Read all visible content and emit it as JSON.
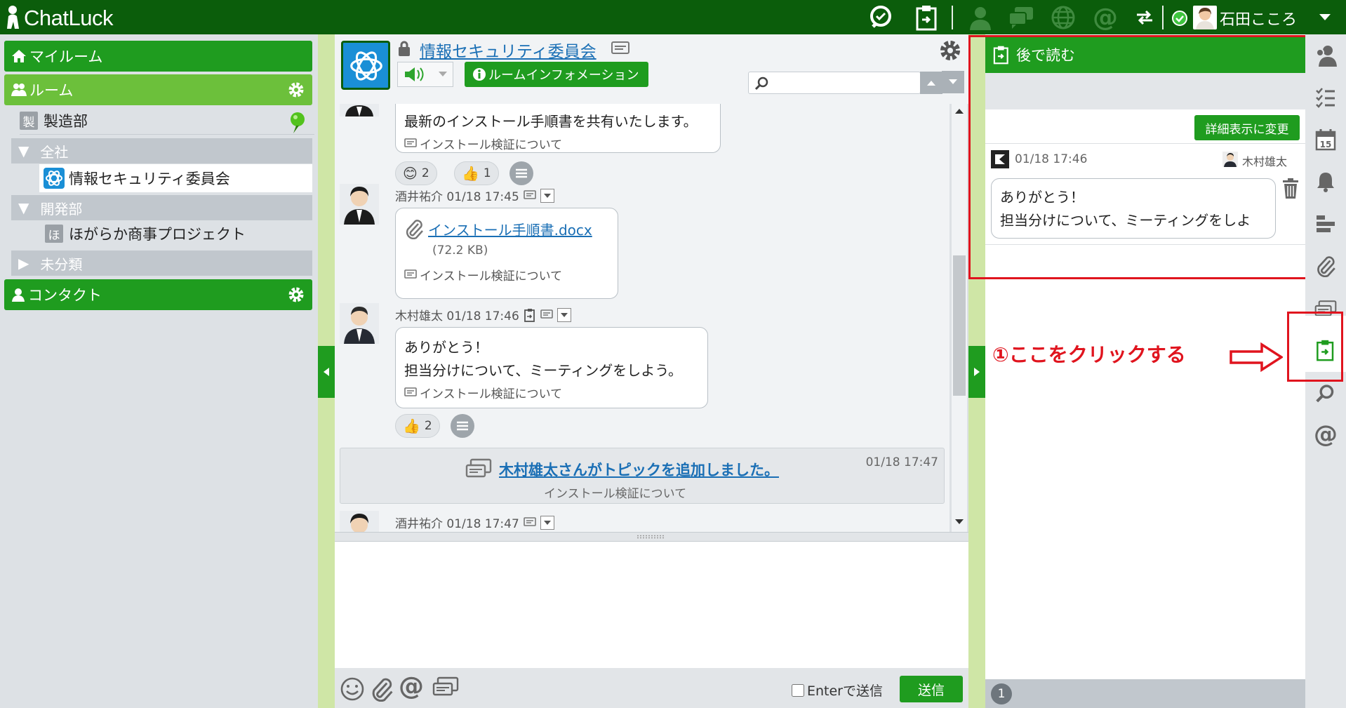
{
  "app": {
    "title": "ChatLuck"
  },
  "user": {
    "name": "石田こころ"
  },
  "sidebar": {
    "my_room": "マイルーム",
    "rooms": "ルーム",
    "seizo_char": "製",
    "seizo": "製造部",
    "zensha": "全社",
    "johosec": "情報セキュリティ委員会",
    "kaihatsu": "開発部",
    "hoga_char": "ほ",
    "hoga": "ほがらか商事プロジェクト",
    "mibunrui": "未分類",
    "contact": "コンタクト"
  },
  "room": {
    "title": "情報セキュリティ委員会",
    "info_button": "ルームインフォメーション",
    "search_placeholder": ""
  },
  "messages": [
    {
      "text": "最新のインストール手順書を共有いたします。",
      "topic": "インストール検証について",
      "reactions": [
        {
          "emoji": "😊",
          "count": "2"
        },
        {
          "emoji": "👍",
          "count": "1"
        }
      ]
    },
    {
      "meta": "酒井祐介 01/18 17:45",
      "file_name": "インストール手順書.docx",
      "file_size": "(72.2 KB)",
      "topic": "インストール検証について"
    },
    {
      "meta": "木村雄太 01/18 17:46",
      "line1": "ありがとう！",
      "line2": "担当分けについて、ミーティングをしよう。",
      "topic": "インストール検証について",
      "reactions": [
        {
          "emoji": "👍",
          "count": "2"
        }
      ]
    },
    {
      "system": "木村雄太さんがトピックを追加しました。",
      "time": "01/18 17:47",
      "topic": "インストール検証について"
    },
    {
      "meta": "酒井祐介 01/18 17:47"
    }
  ],
  "composer": {
    "enter_label": "Enterで送信",
    "send": "送信"
  },
  "read_later": {
    "title": "後で読む",
    "detail_button": "詳細表示に変更",
    "item_time": "01/18 17:46",
    "item_user": "木村雄太",
    "item_line1": "ありがとう！",
    "item_line2": "担当分けについて、ミーティングをしよ",
    "count": "1"
  },
  "annotation": {
    "text": "①ここをクリックする",
    "color": "#e0141e"
  },
  "colors": {
    "top": "#0b5d0b",
    "green": "#1f9c1f",
    "light_green": "#6cc03b",
    "link": "#1a6fb5"
  }
}
